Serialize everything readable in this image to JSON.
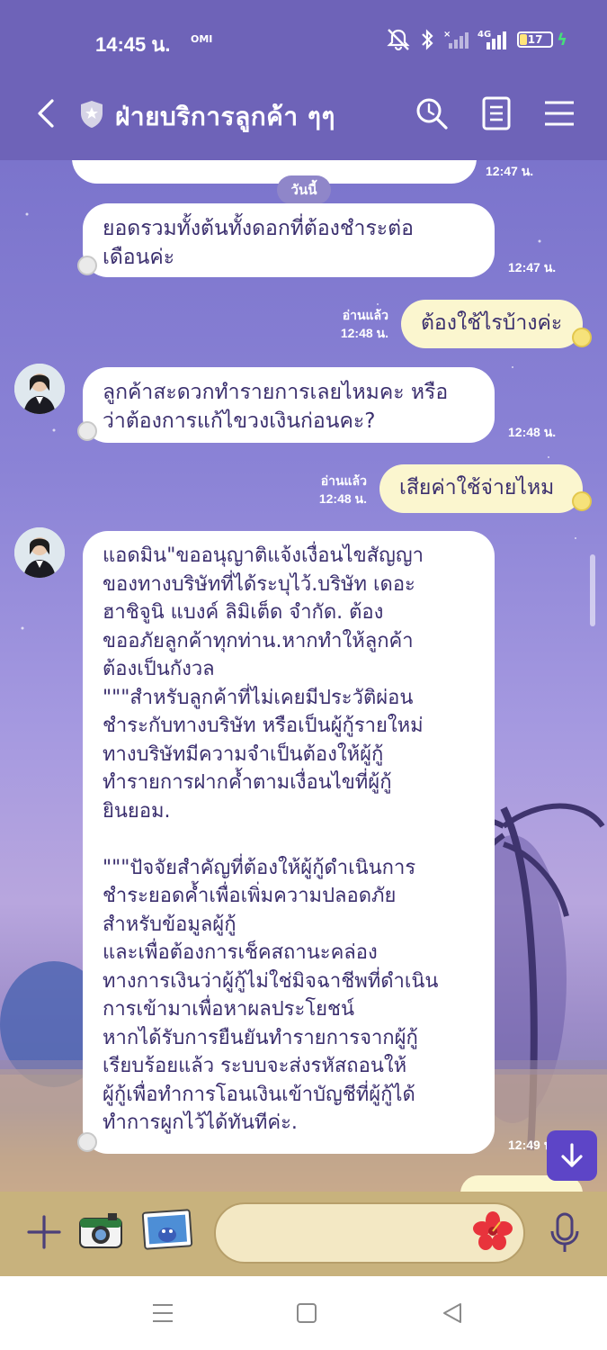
{
  "status_bar": {
    "time": "14:45 น.",
    "carrier": "OMI",
    "network": "4G",
    "battery": "17"
  },
  "header": {
    "title": "ฝ่ายบริการลูกค้า ๆๆ"
  },
  "chat": {
    "date_chip": "วันนี้",
    "messages": [
      {
        "id": "m0",
        "side": "left",
        "text": "",
        "time": "12:47 น."
      },
      {
        "id": "m1",
        "side": "left",
        "text": "ยอดรวมทั้งต้นทั้งดอกที่ต้องชำระต่อ\nเดือนค่ะ",
        "time": "12:47 น."
      },
      {
        "id": "m2",
        "side": "right",
        "text": "ต้องใช้ไรบ้างค่ะ",
        "read": "อ่านแล้ว",
        "time": "12:48 น."
      },
      {
        "id": "m3",
        "side": "left",
        "text": "ลูกค้าสะดวกทำรายการเลยไหมคะ หรือ\nว่าต้องการแก้ไขวงเงินก่อนคะ?",
        "time": "12:48 น."
      },
      {
        "id": "m4",
        "side": "right",
        "text": "เสียค่าใช้จ่ายไหม",
        "read": "อ่านแล้ว",
        "time": "12:48 น."
      },
      {
        "id": "m5",
        "side": "left",
        "text": "แอดมิน\"ขออนุญาติแจ้งเงื่อนไขสัญญา\nของทางบริษัทที่ได้ระบุไว้.บริษัท เดอะ\nฮาชิจูนิ แบงค์ ลิมิเต็ด จำกัด. ต้อง\nขออภัยลูกค้าทุกท่าน.หากทำให้ลูกค้า\nต้องเป็นกังวล\n\"\"\"สำหรับลูกค้าที่ไม่เคยมีประวัติผ่อน\nชำระกับทางบริษัท หรือเป็นผู้กู้รายใหม่\nทางบริษัทมีความจำเป็นต้องให้ผู้กู้\nทำรายการฝากค้ำตามเงื่อนไขที่ผู้กู้\nยินยอม.\n\n\"\"\"ปัจจัยสำคัญที่ต้องให้ผู้กู้ดำเนินการ\nชำระยอดค้ำเพื่อเพิ่มความปลอดภัย\nสำหรับข้อมูลผู้กู้\nและเพื่อต้องการเช็คสถานะคล่อง\nทางการเงินว่าผู้กู้ไม่ใช่มิจฉาชีพที่ดำเนิน\nการเข้ามาเพื่อหาผลประโยชน์\nหากได้รับการยืนยันทำรายการจากผู้กู้\nเรียบร้อยแล้ว ระบบจะส่งรหัสถอนให้\nผู้กู้เพื่อทำการโอนเงินเข้าบัญชีที่ผู้กู้ได้\nทำการผูกไว้ได้ทันทีค่ะ.",
        "time": "12:49 น."
      }
    ]
  },
  "input": {
    "placeholder": ""
  },
  "icons": {
    "back": "chevron-left-icon",
    "shield": "shield-icon",
    "search": "search-icon",
    "notes": "notes-icon",
    "menu": "menu-icon",
    "plus": "plus-icon",
    "camera": "camera-icon",
    "gallery": "gallery-icon",
    "emoji": "hibiscus-emoji-icon",
    "mic": "microphone-icon",
    "scroll_down": "arrow-down-icon"
  },
  "colors": {
    "header": "#6e63b8",
    "accent": "#5d45c7",
    "bubble_mine": "#fbf6cf",
    "input_bar": "#c8b27d"
  }
}
